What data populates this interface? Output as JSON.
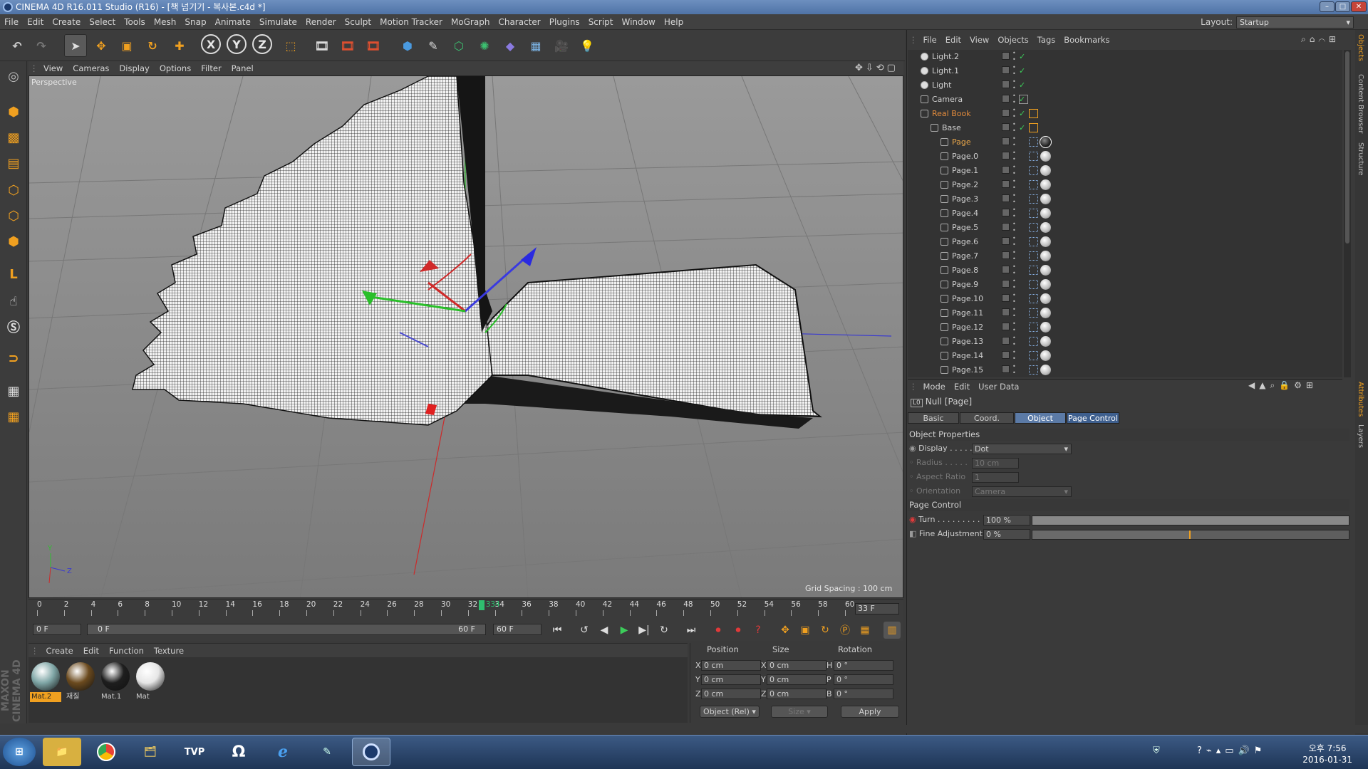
{
  "window": {
    "title": "CINEMA 4D R16.011 Studio (R16) - [책 넘기기 - 복사본.c4d *]"
  },
  "menubar": [
    "File",
    "Edit",
    "Create",
    "Select",
    "Tools",
    "Mesh",
    "Snap",
    "Animate",
    "Simulate",
    "Render",
    "Sculpt",
    "Motion Tracker",
    "MoGraph",
    "Character",
    "Plugins",
    "Script",
    "Window",
    "Help"
  ],
  "layout": {
    "label": "Layout:",
    "value": "Startup"
  },
  "toolbar": {
    "x_label": "X",
    "y_label": "Y",
    "z_label": "Z"
  },
  "viewport": {
    "menu": [
      "View",
      "Cameras",
      "Display",
      "Options",
      "Filter",
      "Panel"
    ],
    "label": "Perspective",
    "grid_spacing": "Grid Spacing : 100 cm"
  },
  "timeline": {
    "ticks": [
      "0",
      "2",
      "4",
      "6",
      "8",
      "10",
      "12",
      "14",
      "16",
      "18",
      "20",
      "22",
      "24",
      "26",
      "28",
      "30",
      "32",
      "34",
      "36",
      "38",
      "40",
      "42",
      "44",
      "46",
      "48",
      "50",
      "52",
      "54",
      "56",
      "58",
      "60"
    ],
    "current_frame": "33 F",
    "playhead_label": "334",
    "start": "0 F",
    "range_start": "0 F",
    "range_end": "60 F",
    "end": "60 F"
  },
  "material_manager": {
    "menu": [
      "Create",
      "Edit",
      "Function",
      "Texture"
    ],
    "materials": [
      {
        "name": "Mat.2",
        "color": "#7fa6a6"
      },
      {
        "name": "재질",
        "color": "#6b4a1e"
      },
      {
        "name": "Mat.1",
        "color": "#1e1e1e"
      },
      {
        "name": "Mat",
        "color": "#e6e6e6"
      }
    ]
  },
  "coordinates": {
    "headers": {
      "position": "Position",
      "size": "Size",
      "rotation": "Rotation"
    },
    "rows": [
      {
        "axis": "X",
        "pos": "0 cm",
        "size_axis": "X",
        "size": "0 cm",
        "rot_axis": "H",
        "rot": "0 °"
      },
      {
        "axis": "Y",
        "pos": "0 cm",
        "size_axis": "Y",
        "size": "0 cm",
        "rot_axis": "P",
        "rot": "0 °"
      },
      {
        "axis": "Z",
        "pos": "0 cm",
        "size_axis": "Z",
        "size": "0 cm",
        "rot_axis": "B",
        "rot": "0 °"
      }
    ],
    "mode": "Object (Rel)",
    "size_mode": "Size",
    "apply": "Apply"
  },
  "branding": "MAXON CINEMA 4D",
  "object_manager": {
    "menu": [
      "File",
      "Edit",
      "View",
      "Objects",
      "Tags",
      "Bookmarks"
    ],
    "objects": [
      {
        "name": "Light.2",
        "indent": 0
      },
      {
        "name": "Light.1",
        "indent": 0
      },
      {
        "name": "Light",
        "indent": 0
      },
      {
        "name": "Camera",
        "indent": 0
      },
      {
        "name": "Real Book",
        "indent": 0,
        "highlight": "#e08a3c"
      },
      {
        "name": "Base",
        "indent": 1
      },
      {
        "name": "Page",
        "indent": 2,
        "highlight": "#e8a64a"
      },
      {
        "name": "Page.0",
        "indent": 2
      },
      {
        "name": "Page.1",
        "indent": 2
      },
      {
        "name": "Page.2",
        "indent": 2
      },
      {
        "name": "Page.3",
        "indent": 2
      },
      {
        "name": "Page.4",
        "indent": 2
      },
      {
        "name": "Page.5",
        "indent": 2
      },
      {
        "name": "Page.6",
        "indent": 2
      },
      {
        "name": "Page.7",
        "indent": 2
      },
      {
        "name": "Page.8",
        "indent": 2
      },
      {
        "name": "Page.9",
        "indent": 2
      },
      {
        "name": "Page.10",
        "indent": 2
      },
      {
        "name": "Page.11",
        "indent": 2
      },
      {
        "name": "Page.12",
        "indent": 2
      },
      {
        "name": "Page.13",
        "indent": 2
      },
      {
        "name": "Page.14",
        "indent": 2
      },
      {
        "name": "Page.15",
        "indent": 2
      }
    ]
  },
  "attributes": {
    "menu": [
      "Mode",
      "Edit",
      "User Data"
    ],
    "object_name": "Null [Page]",
    "tabs": [
      "Basic",
      "Coord.",
      "Object",
      "Page Control"
    ],
    "object_properties": "Object Properties",
    "display_label": "Display . . . . .",
    "display_value": "Dot",
    "radius_label": "Radius . . . . .",
    "radius_value": "10 cm",
    "aspect_label": "Aspect Ratio",
    "aspect_value": "1",
    "orientation_label": "Orientation",
    "orientation_value": "Camera",
    "page_control": "Page Control",
    "turn_label": "Turn . . . . . . . . .",
    "turn_value": "100 %",
    "turn_fraction": 1.0,
    "fine_label": "Fine Adjustment",
    "fine_value": "0 %",
    "fine_fraction": 0.5
  },
  "side_tabs": [
    "Objects",
    "Content Browser",
    "Structure",
    "Attributes",
    "Layers"
  ],
  "taskbar": {
    "time": "오후 7:56",
    "date": "2016-01-31",
    "tvp": "TVP"
  }
}
